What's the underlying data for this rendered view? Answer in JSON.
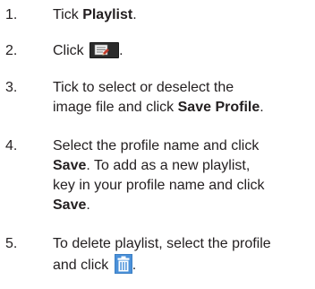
{
  "steps": [
    {
      "number": "1.",
      "text_before": "Tick ",
      "bold": "Playlist",
      "text_after": "."
    },
    {
      "number": "2.",
      "text_before": "Click ",
      "icon": "playlist-button-icon",
      "text_after": "."
    },
    {
      "number": "3.",
      "line1": "Tick to select or deselect the",
      "line2_before": "image file and click ",
      "line2_bold": "Save Profile",
      "line2_after": "."
    },
    {
      "number": "4.",
      "line1": "Select the profile name and click",
      "line2_bold": "Save",
      "line2_after": ". To add as a new playlist,",
      "line3": "key in your profile name and click",
      "line4_bold": "Save",
      "line4_after": "."
    },
    {
      "number": "5.",
      "line1": "To delete playlist, select the profile",
      "line2_before": "and click ",
      "icon": "trash-icon",
      "line2_after": "."
    }
  ],
  "colors": {
    "text": "#231f20",
    "icon_dark": "#1a1a1a",
    "icon_red": "#c0392b",
    "trash_blue": "#3b7fc4"
  }
}
